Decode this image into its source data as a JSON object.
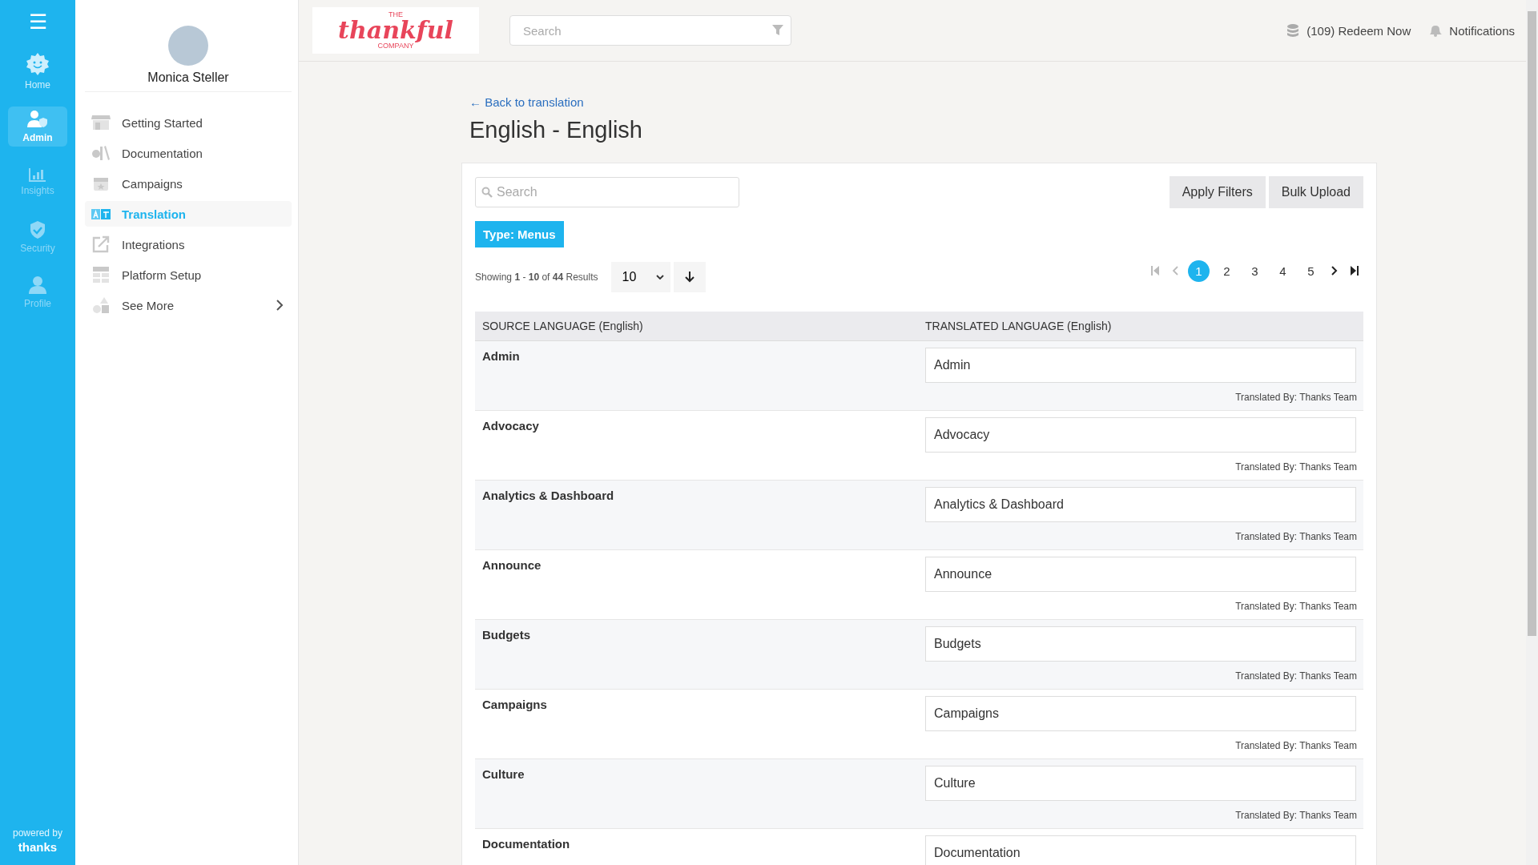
{
  "rail": {
    "menu_icon": "☰",
    "items": [
      {
        "label": "Home",
        "kind": "home",
        "selected": false
      },
      {
        "label": "Admin",
        "kind": "admin",
        "selected": true
      },
      {
        "label": "Insights",
        "kind": "insights",
        "selected": false
      },
      {
        "label": "Security",
        "kind": "security",
        "selected": false
      },
      {
        "label": "Profile",
        "kind": "profile",
        "selected": false
      }
    ],
    "powered_by": "powered by",
    "brand": "thanks"
  },
  "sidebar": {
    "user_name": "Monica Steller",
    "items": [
      {
        "label": "Getting Started",
        "kind": "store",
        "selected": false
      },
      {
        "label": "Documentation",
        "kind": "docs",
        "selected": false
      },
      {
        "label": "Campaigns",
        "kind": "calendar",
        "selected": false
      },
      {
        "label": "Translation",
        "kind": "translate",
        "selected": true
      },
      {
        "label": "Integrations",
        "kind": "external",
        "selected": false
      },
      {
        "label": "Platform Setup",
        "kind": "grid",
        "selected": false
      },
      {
        "label": "See More",
        "kind": "shapes",
        "selected": false,
        "expandable": true
      }
    ]
  },
  "header": {
    "logo": {
      "top": "THE",
      "main": "thankful",
      "bottom": "COMPANY"
    },
    "search": {
      "placeholder": "Search"
    },
    "points": "(109) Redeem Now",
    "notifications": "Notifications"
  },
  "page": {
    "back_icon": "←",
    "back_link": "Back to translation",
    "title": "English - English",
    "search": {
      "placeholder": "Search"
    },
    "buttons": [
      "Apply Filters",
      "Bulk Upload"
    ],
    "filter_tag": "Type: Menus",
    "results": "Showing **1** - **10** of **44** Results",
    "page_size": "10",
    "pagination": [
      {
        "label": "1",
        "selected": true
      },
      {
        "label": "2",
        "selected": false
      },
      {
        "label": "3",
        "selected": false
      },
      {
        "label": "4",
        "selected": false
      },
      {
        "label": "5",
        "selected": false
      }
    ],
    "table": {
      "columns": [
        "SOURCE LANGUAGE (English)",
        "TRANSLATED LANGUAGE (English)"
      ],
      "rows": [
        {
          "source": "Admin",
          "translation": "Admin",
          "credit": "Translated By: Thanks Team"
        },
        {
          "source": "Advocacy",
          "translation": "Advocacy",
          "credit": "Translated By: Thanks Team"
        },
        {
          "source": "Analytics & Dashboard",
          "translation": "Analytics & Dashboard",
          "credit": "Translated By: Thanks Team"
        },
        {
          "source": "Announce",
          "translation": "Announce",
          "credit": "Translated By: Thanks Team"
        },
        {
          "source": "Budgets",
          "translation": "Budgets",
          "credit": "Translated By: Thanks Team"
        },
        {
          "source": "Campaigns",
          "translation": "Campaigns",
          "credit": "Translated By: Thanks Team"
        },
        {
          "source": "Culture",
          "translation": "Culture",
          "credit": "Translated By: Thanks Team"
        },
        {
          "source": "Documentation",
          "translation": "Documentation"
        }
      ]
    }
  }
}
